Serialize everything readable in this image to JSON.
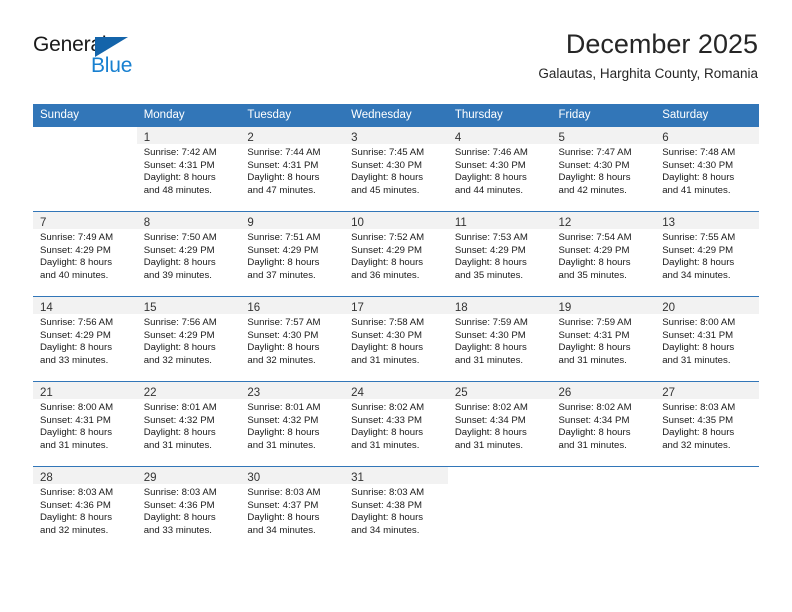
{
  "logo": {
    "word_top": "General",
    "word_bottom": "Blue",
    "triangle_icon": "triangle-icon",
    "color_dark": "#1a1a1a",
    "color_blue": "#1880d0",
    "color_triangle": "#1464aa"
  },
  "header": {
    "month_year": "December 2025",
    "location": "Galautas, Harghita County, Romania"
  },
  "theme": {
    "header_bg": "#3276b8",
    "header_text": "#ffffff",
    "daynum_band_bg": "#f2f2f2",
    "row_divider": "#3276b8",
    "body_text": "#1a1a1a"
  },
  "calendar": {
    "weekday_headers": [
      "Sunday",
      "Monday",
      "Tuesday",
      "Wednesday",
      "Thursday",
      "Friday",
      "Saturday"
    ],
    "weeks": [
      [
        {
          "day": "",
          "lines": []
        },
        {
          "day": "1",
          "lines": [
            "Sunrise: 7:42 AM",
            "Sunset: 4:31 PM",
            "Daylight: 8 hours",
            "and 48 minutes."
          ]
        },
        {
          "day": "2",
          "lines": [
            "Sunrise: 7:44 AM",
            "Sunset: 4:31 PM",
            "Daylight: 8 hours",
            "and 47 minutes."
          ]
        },
        {
          "day": "3",
          "lines": [
            "Sunrise: 7:45 AM",
            "Sunset: 4:30 PM",
            "Daylight: 8 hours",
            "and 45 minutes."
          ]
        },
        {
          "day": "4",
          "lines": [
            "Sunrise: 7:46 AM",
            "Sunset: 4:30 PM",
            "Daylight: 8 hours",
            "and 44 minutes."
          ]
        },
        {
          "day": "5",
          "lines": [
            "Sunrise: 7:47 AM",
            "Sunset: 4:30 PM",
            "Daylight: 8 hours",
            "and 42 minutes."
          ]
        },
        {
          "day": "6",
          "lines": [
            "Sunrise: 7:48 AM",
            "Sunset: 4:30 PM",
            "Daylight: 8 hours",
            "and 41 minutes."
          ]
        }
      ],
      [
        {
          "day": "7",
          "lines": [
            "Sunrise: 7:49 AM",
            "Sunset: 4:29 PM",
            "Daylight: 8 hours",
            "and 40 minutes."
          ]
        },
        {
          "day": "8",
          "lines": [
            "Sunrise: 7:50 AM",
            "Sunset: 4:29 PM",
            "Daylight: 8 hours",
            "and 39 minutes."
          ]
        },
        {
          "day": "9",
          "lines": [
            "Sunrise: 7:51 AM",
            "Sunset: 4:29 PM",
            "Daylight: 8 hours",
            "and 37 minutes."
          ]
        },
        {
          "day": "10",
          "lines": [
            "Sunrise: 7:52 AM",
            "Sunset: 4:29 PM",
            "Daylight: 8 hours",
            "and 36 minutes."
          ]
        },
        {
          "day": "11",
          "lines": [
            "Sunrise: 7:53 AM",
            "Sunset: 4:29 PM",
            "Daylight: 8 hours",
            "and 35 minutes."
          ]
        },
        {
          "day": "12",
          "lines": [
            "Sunrise: 7:54 AM",
            "Sunset: 4:29 PM",
            "Daylight: 8 hours",
            "and 35 minutes."
          ]
        },
        {
          "day": "13",
          "lines": [
            "Sunrise: 7:55 AM",
            "Sunset: 4:29 PM",
            "Daylight: 8 hours",
            "and 34 minutes."
          ]
        }
      ],
      [
        {
          "day": "14",
          "lines": [
            "Sunrise: 7:56 AM",
            "Sunset: 4:29 PM",
            "Daylight: 8 hours",
            "and 33 minutes."
          ]
        },
        {
          "day": "15",
          "lines": [
            "Sunrise: 7:56 AM",
            "Sunset: 4:29 PM",
            "Daylight: 8 hours",
            "and 32 minutes."
          ]
        },
        {
          "day": "16",
          "lines": [
            "Sunrise: 7:57 AM",
            "Sunset: 4:30 PM",
            "Daylight: 8 hours",
            "and 32 minutes."
          ]
        },
        {
          "day": "17",
          "lines": [
            "Sunrise: 7:58 AM",
            "Sunset: 4:30 PM",
            "Daylight: 8 hours",
            "and 31 minutes."
          ]
        },
        {
          "day": "18",
          "lines": [
            "Sunrise: 7:59 AM",
            "Sunset: 4:30 PM",
            "Daylight: 8 hours",
            "and 31 minutes."
          ]
        },
        {
          "day": "19",
          "lines": [
            "Sunrise: 7:59 AM",
            "Sunset: 4:31 PM",
            "Daylight: 8 hours",
            "and 31 minutes."
          ]
        },
        {
          "day": "20",
          "lines": [
            "Sunrise: 8:00 AM",
            "Sunset: 4:31 PM",
            "Daylight: 8 hours",
            "and 31 minutes."
          ]
        }
      ],
      [
        {
          "day": "21",
          "lines": [
            "Sunrise: 8:00 AM",
            "Sunset: 4:31 PM",
            "Daylight: 8 hours",
            "and 31 minutes."
          ]
        },
        {
          "day": "22",
          "lines": [
            "Sunrise: 8:01 AM",
            "Sunset: 4:32 PM",
            "Daylight: 8 hours",
            "and 31 minutes."
          ]
        },
        {
          "day": "23",
          "lines": [
            "Sunrise: 8:01 AM",
            "Sunset: 4:32 PM",
            "Daylight: 8 hours",
            "and 31 minutes."
          ]
        },
        {
          "day": "24",
          "lines": [
            "Sunrise: 8:02 AM",
            "Sunset: 4:33 PM",
            "Daylight: 8 hours",
            "and 31 minutes."
          ]
        },
        {
          "day": "25",
          "lines": [
            "Sunrise: 8:02 AM",
            "Sunset: 4:34 PM",
            "Daylight: 8 hours",
            "and 31 minutes."
          ]
        },
        {
          "day": "26",
          "lines": [
            "Sunrise: 8:02 AM",
            "Sunset: 4:34 PM",
            "Daylight: 8 hours",
            "and 31 minutes."
          ]
        },
        {
          "day": "27",
          "lines": [
            "Sunrise: 8:03 AM",
            "Sunset: 4:35 PM",
            "Daylight: 8 hours",
            "and 32 minutes."
          ]
        }
      ],
      [
        {
          "day": "28",
          "lines": [
            "Sunrise: 8:03 AM",
            "Sunset: 4:36 PM",
            "Daylight: 8 hours",
            "and 32 minutes."
          ]
        },
        {
          "day": "29",
          "lines": [
            "Sunrise: 8:03 AM",
            "Sunset: 4:36 PM",
            "Daylight: 8 hours",
            "and 33 minutes."
          ]
        },
        {
          "day": "30",
          "lines": [
            "Sunrise: 8:03 AM",
            "Sunset: 4:37 PM",
            "Daylight: 8 hours",
            "and 34 minutes."
          ]
        },
        {
          "day": "31",
          "lines": [
            "Sunrise: 8:03 AM",
            "Sunset: 4:38 PM",
            "Daylight: 8 hours",
            "and 34 minutes."
          ]
        },
        {
          "day": "",
          "lines": []
        },
        {
          "day": "",
          "lines": []
        },
        {
          "day": "",
          "lines": []
        }
      ]
    ]
  }
}
